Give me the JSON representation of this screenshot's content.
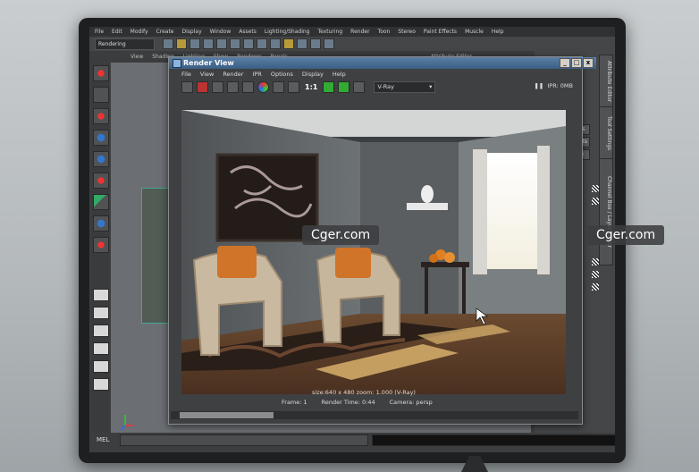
{
  "maya": {
    "menu": [
      "File",
      "Edit",
      "Modify",
      "Create",
      "Display",
      "Window",
      "Assets",
      "Lighting/Shading",
      "Texturing",
      "Render",
      "Toon",
      "Stereo",
      "Paint Effects",
      "Muscle",
      "Help"
    ],
    "mode": "Rendering",
    "shelf_tabs": [
      "View",
      "Shading",
      "Lighting",
      "Show",
      "Renderer",
      "Panels"
    ],
    "attribute_editor": "Attribute Editor",
    "right_buttons": [
      "Focus",
      "Presets",
      "Hide"
    ],
    "side_tabs": [
      "Attribute Editor",
      "Tool Settings",
      "Channel Box / Layer Editor"
    ],
    "mel_label": "MEL"
  },
  "render_view": {
    "title": "Render View",
    "window_buttons": [
      "_",
      "□",
      "x"
    ],
    "menu": [
      "File",
      "View",
      "Render",
      "IPR",
      "Options",
      "Display",
      "Help"
    ],
    "ratio_label": "1:1",
    "renderer": "V-Ray",
    "ipr_label": "IPR: 0MB",
    "info_line": "size:640 x 480 zoom: 1.000        (V-Ray)",
    "frame": "Frame: 1",
    "render_time": "Render Time: 0:44",
    "camera": "Camera: persp"
  },
  "watermarks": [
    "Cger.com",
    "Cger.com"
  ],
  "colors": {
    "titlebar": "#3a5e84",
    "accent_red": "#e33333"
  }
}
